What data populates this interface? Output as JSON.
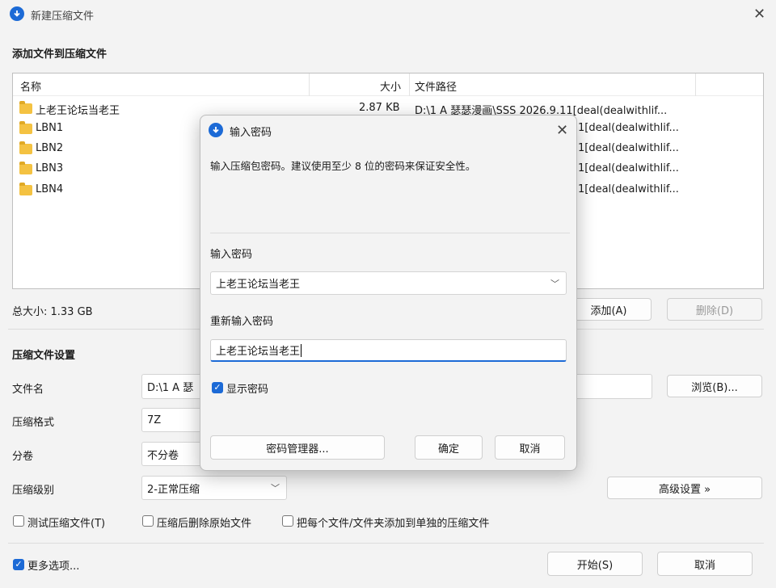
{
  "window": {
    "title": "新建压缩文件",
    "close_icon": "close-icon"
  },
  "add_section": {
    "title": "添加文件到压缩文件",
    "columns": [
      "名称",
      "大小",
      "文件路径"
    ],
    "rows": [
      {
        "name": "上老王论坛当老王",
        "size": "2.87 KB",
        "path": "D:\\1 A 瑟瑟漫画\\SSS 2026.9.11[deal(dealwithlif..."
      },
      {
        "name": "LBN1",
        "size": "",
        "path": "1[deal(dealwithlif..."
      },
      {
        "name": "LBN2",
        "size": "",
        "path": "1[deal(dealwithlif..."
      },
      {
        "name": "LBN3",
        "size": "",
        "path": "1[deal(dealwithlif..."
      },
      {
        "name": "LBN4",
        "size": "",
        "path": "1[deal(dealwithlif..."
      }
    ],
    "total_size": "总大小: 1.33 GB",
    "add_button": "添加(A)",
    "delete_button": "删除(D)"
  },
  "settings": {
    "title": "压缩文件设置",
    "filename_label": "文件名",
    "filename_value": "D:\\1 A 瑟",
    "browse_button": "浏览(B)...",
    "format_label": "压缩格式",
    "format_value": "7Z",
    "volume_label": "分卷",
    "volume_value": "不分卷",
    "level_label": "压缩级别",
    "level_value": "2-正常压缩",
    "advanced_button": "高级设置 »",
    "test_checkbox": "测试压缩文件(T)",
    "delete_after_checkbox": "压缩后删除原始文件",
    "separate_checkbox": "把每个文件/文件夹添加到单独的压缩文件",
    "more_options": "更多选项...",
    "start_button": "开始(S)",
    "cancel_button": "取消"
  },
  "password_dialog": {
    "title": "输入密码",
    "description": "输入压缩包密码。建议使用至少 8 位的密码来保证安全性。",
    "password_label": "输入密码",
    "password_value": "上老王论坛当老王",
    "reenter_label": "重新输入密码",
    "reenter_value": "上老王论坛当老王",
    "show_password": "显示密码",
    "manager_button": "密码管理器...",
    "ok_button": "确定",
    "cancel_button": "取消"
  }
}
